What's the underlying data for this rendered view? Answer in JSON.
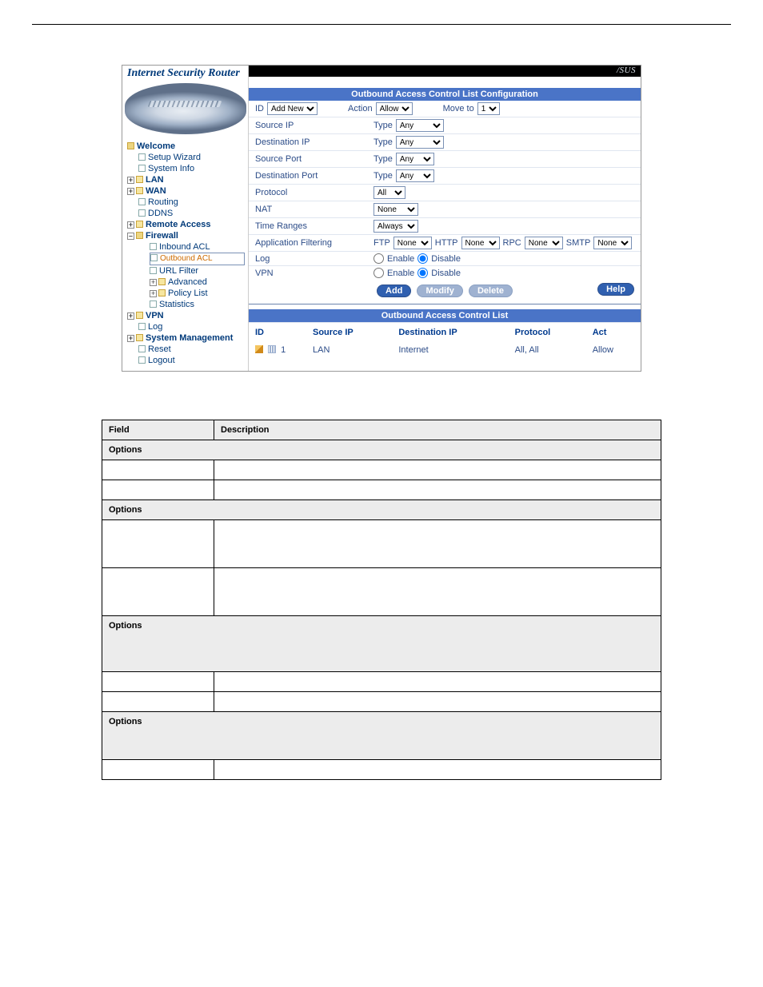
{
  "side_title": "Internet Security Router",
  "brand": "/SUS",
  "nav": {
    "welcome": "Welcome",
    "setup": "Setup Wizard",
    "sysinfo": "System Info",
    "lan": "LAN",
    "wan": "WAN",
    "routing": "Routing",
    "ddns": "DDNS",
    "remote": "Remote Access",
    "firewall": "Firewall",
    "in_acl": "Inbound ACL",
    "out_acl": "Outbound ACL",
    "url": "URL Filter",
    "advanced": "Advanced",
    "policy": "Policy List",
    "stats": "Statistics",
    "vpn": "VPN",
    "log": "Log",
    "sysmgmt": "System Management",
    "reset": "Reset",
    "logout": "Logout"
  },
  "form": {
    "title": "Outbound Access Control List Configuration",
    "id_label": "ID",
    "id_value": "Add New",
    "action_label": "Action",
    "action_value": "Allow",
    "moveto_label": "Move to",
    "moveto_value": "1",
    "srcip_label": "Source IP",
    "dstip_label": "Destination IP",
    "srcport_label": "Source Port",
    "dstport_label": "Destination Port",
    "type_label": "Type",
    "type_value": "Any",
    "proto_label": "Protocol",
    "proto_value": "All",
    "nat_label": "NAT",
    "nat_value": "None",
    "time_label": "Time Ranges",
    "time_value": "Always",
    "appf_label": "Application Filtering",
    "ftp": "FTP",
    "http": "HTTP",
    "rpc": "RPC",
    "smtp": "SMTP",
    "none": "None",
    "log_label": "Log",
    "vpn_label": "VPN",
    "enable": "Enable",
    "disable": "Disable",
    "btn_add": "Add",
    "btn_modify": "Modify",
    "btn_delete": "Delete",
    "btn_help": "Help"
  },
  "list": {
    "title": "Outbound Access Control List",
    "h_id": "ID",
    "h_src": "Source IP",
    "h_dst": "Destination IP",
    "h_proto": "Protocol",
    "h_act": "Act",
    "row": {
      "id": "1",
      "src": "LAN",
      "dst": "Internet",
      "proto": "All, All",
      "act": "Allow"
    }
  },
  "table": {
    "h_field": "Field",
    "h_desc": "Description",
    "options": "Options"
  }
}
